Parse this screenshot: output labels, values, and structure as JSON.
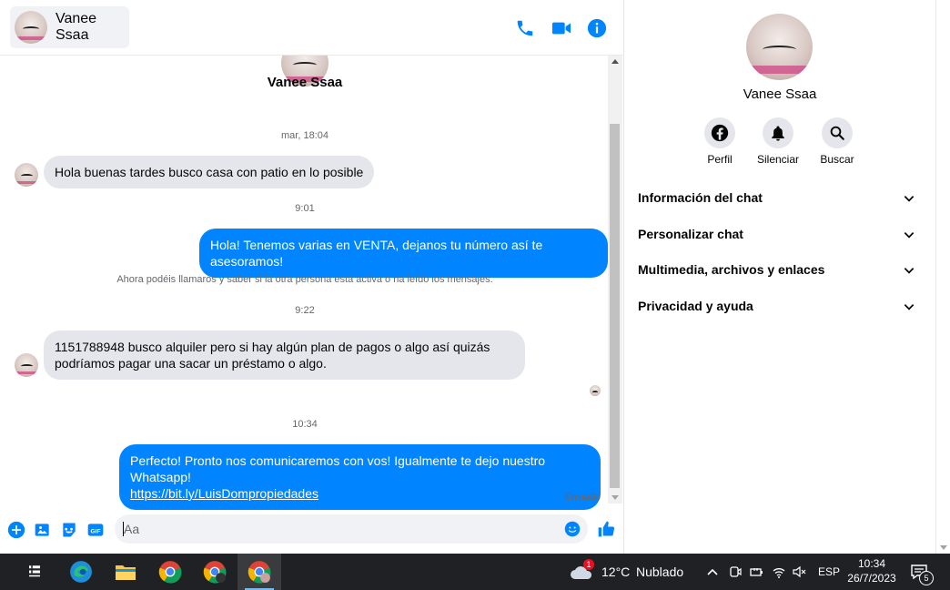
{
  "header": {
    "contact_name": "Vanee Ssaa"
  },
  "thread": {
    "top_name": "Vanee Ssaa",
    "messages": [
      {
        "time": "mar, 18:04",
        "direction": "in",
        "text": "Hola buenas tardes busco casa con patio en lo posible"
      },
      {
        "time": "9:01",
        "direction": "out",
        "text": "Hola! Tenemos varias en VENTA, dejanos tu número así te asesoramos!"
      },
      {
        "direction": "system",
        "text": "Ahora podéis llamaros y saber si la otra persona está activa o ha leído los mensajes."
      },
      {
        "time": "9:22",
        "direction": "in",
        "text_line1": "1151788948 busco alquiler pero si hay algún plan de pagos o algo así quizás",
        "text_line2": "podríamos pagar una sacar un préstamo o algo."
      },
      {
        "time": "10:34",
        "direction": "out",
        "text_line1": "Perfecto! Pronto nos comunicaremos con vos! Igualmente te dejo nuestro Whatsapp!",
        "link": "https://bit.ly/LuisDompropiedades",
        "status": "Enviado"
      }
    ]
  },
  "composer": {
    "placeholder": "Aa"
  },
  "info": {
    "name": "Vanee Ssaa",
    "actions": [
      {
        "label": "Perfil",
        "icon": "facebook-icon"
      },
      {
        "label": "Silenciar",
        "icon": "bell-icon"
      },
      {
        "label": "Buscar",
        "icon": "search-icon"
      }
    ],
    "sections": [
      "Información del chat",
      "Personalizar chat",
      "Multimedia, archivos y enlaces",
      "Privacidad y ayuda"
    ]
  },
  "taskbar": {
    "weather_badge": "1",
    "weather_temp": "12°C",
    "weather_desc": "Nublado",
    "lang": "ESP",
    "time": "10:34",
    "date": "26/7/2023",
    "notifications": "5"
  },
  "colors": {
    "accent": "#0084ff",
    "bubble_in": "#e4e6eb",
    "taskbar": "#202124"
  }
}
